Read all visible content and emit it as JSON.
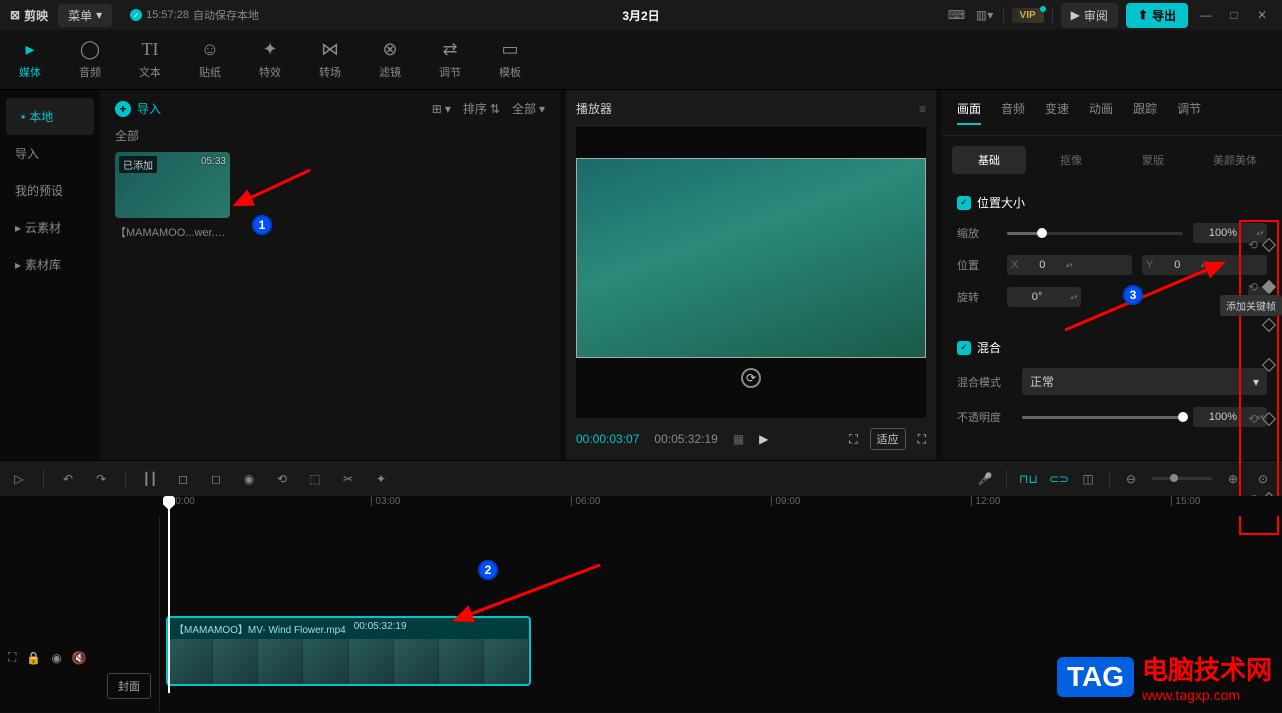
{
  "titlebar": {
    "app_name": "剪映",
    "menu_label": "菜单",
    "save_time": "15:57:28",
    "save_text": "自动保存本地",
    "project_title": "3月2日",
    "vip_label": "VIP",
    "review_label": "审阅",
    "export_label": "导出"
  },
  "main_tabs": [
    {
      "icon": "▸",
      "label": "媒体",
      "active": true
    },
    {
      "icon": "◯",
      "label": "音频"
    },
    {
      "icon": "TI",
      "label": "文本"
    },
    {
      "icon": "☺",
      "label": "贴纸"
    },
    {
      "icon": "✦",
      "label": "特效"
    },
    {
      "icon": "⋈",
      "label": "转场"
    },
    {
      "icon": "⊗",
      "label": "滤镜"
    },
    {
      "icon": "⇄",
      "label": "调节"
    },
    {
      "icon": "▭",
      "label": "模板"
    }
  ],
  "left_sidebar": [
    {
      "label": "本地",
      "active": true
    },
    {
      "label": "导入"
    },
    {
      "label": "我的预设"
    },
    {
      "label": "云素材",
      "chevron": true
    },
    {
      "label": "素材库",
      "chevron": true
    }
  ],
  "media": {
    "import_label": "导入",
    "view_toggle": "⊞",
    "sort_label": "排序",
    "filter_label": "全部",
    "category": "全部",
    "clip": {
      "badge": "已添加",
      "duration": "05:33",
      "name": "【MAMAMOO...wer.mp4"
    }
  },
  "player": {
    "title": "播放器",
    "current_time": "00:00:03:07",
    "total_time": "00:05:32:19",
    "fit_label": "适应"
  },
  "props": {
    "tabs": [
      "画面",
      "音频",
      "变速",
      "动画",
      "跟踪",
      "调节"
    ],
    "active_tab": "画面",
    "subtabs": [
      "基础",
      "抠像",
      "蒙版",
      "美颜美体"
    ],
    "active_subtab": "基础",
    "section_transform": "位置大小",
    "scale_label": "缩放",
    "scale_value": "100%",
    "position_label": "位置",
    "pos_x_label": "X",
    "pos_x_value": "0",
    "pos_y_label": "Y",
    "pos_y_value": "0",
    "rotation_label": "旋转",
    "rotation_value": "0°",
    "section_blend": "混合",
    "blend_mode_label": "混合模式",
    "blend_mode_value": "正常",
    "opacity_label": "不透明度",
    "opacity_value": "100%",
    "kf_tooltip": "添加关键帧"
  },
  "timeline": {
    "ruler_marks": [
      "0:00",
      "03:00",
      "06:00",
      "09:00",
      "12:00",
      "15:00"
    ],
    "cover_label": "封面",
    "clip_title": "【MAMAMOO】MV- Wind Flower.mp4",
    "clip_duration": "00:05:32:19"
  },
  "watermark": {
    "tag": "TAG",
    "text": "电脑技术网",
    "url": "www.tagxp.com"
  },
  "annotations": {
    "a1": "1",
    "a2": "2",
    "a3": "3"
  }
}
